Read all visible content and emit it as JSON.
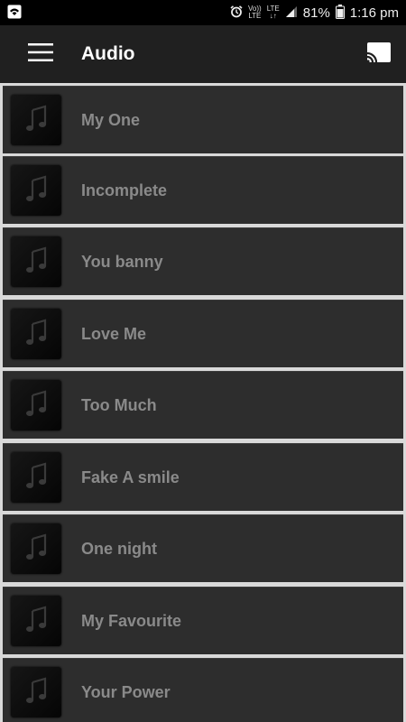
{
  "status_bar": {
    "wifi_icon": "wifi-icon",
    "alarm_icon": "alarm-icon",
    "volte_top": "Vo))",
    "volte_bottom": "LTE",
    "lte_top": "LTE",
    "lte_bottom": "↓↑",
    "signal_icon": "signal-icon",
    "battery_pct": "81%",
    "battery_icon": "battery-icon",
    "time": "1:16 pm"
  },
  "app_bar": {
    "menu_icon": "hamburger-menu-icon",
    "title": "Audio",
    "cast_icon": "cast-icon"
  },
  "tracks": [
    {
      "title": "My One"
    },
    {
      "title": "Incomplete"
    },
    {
      "title": "You banny"
    },
    {
      "title": "Love Me"
    },
    {
      "title": "Too Much"
    },
    {
      "title": "Fake A smile"
    },
    {
      "title": "One night"
    },
    {
      "title": "My Favourite"
    },
    {
      "title": "Your Power"
    }
  ],
  "colors": {
    "app_bar": "#202020",
    "list_item": "#2d2d2d",
    "list_separator": "#d9d9d9",
    "item_text": "#8a8a8a",
    "title_text": "#ffffff"
  }
}
